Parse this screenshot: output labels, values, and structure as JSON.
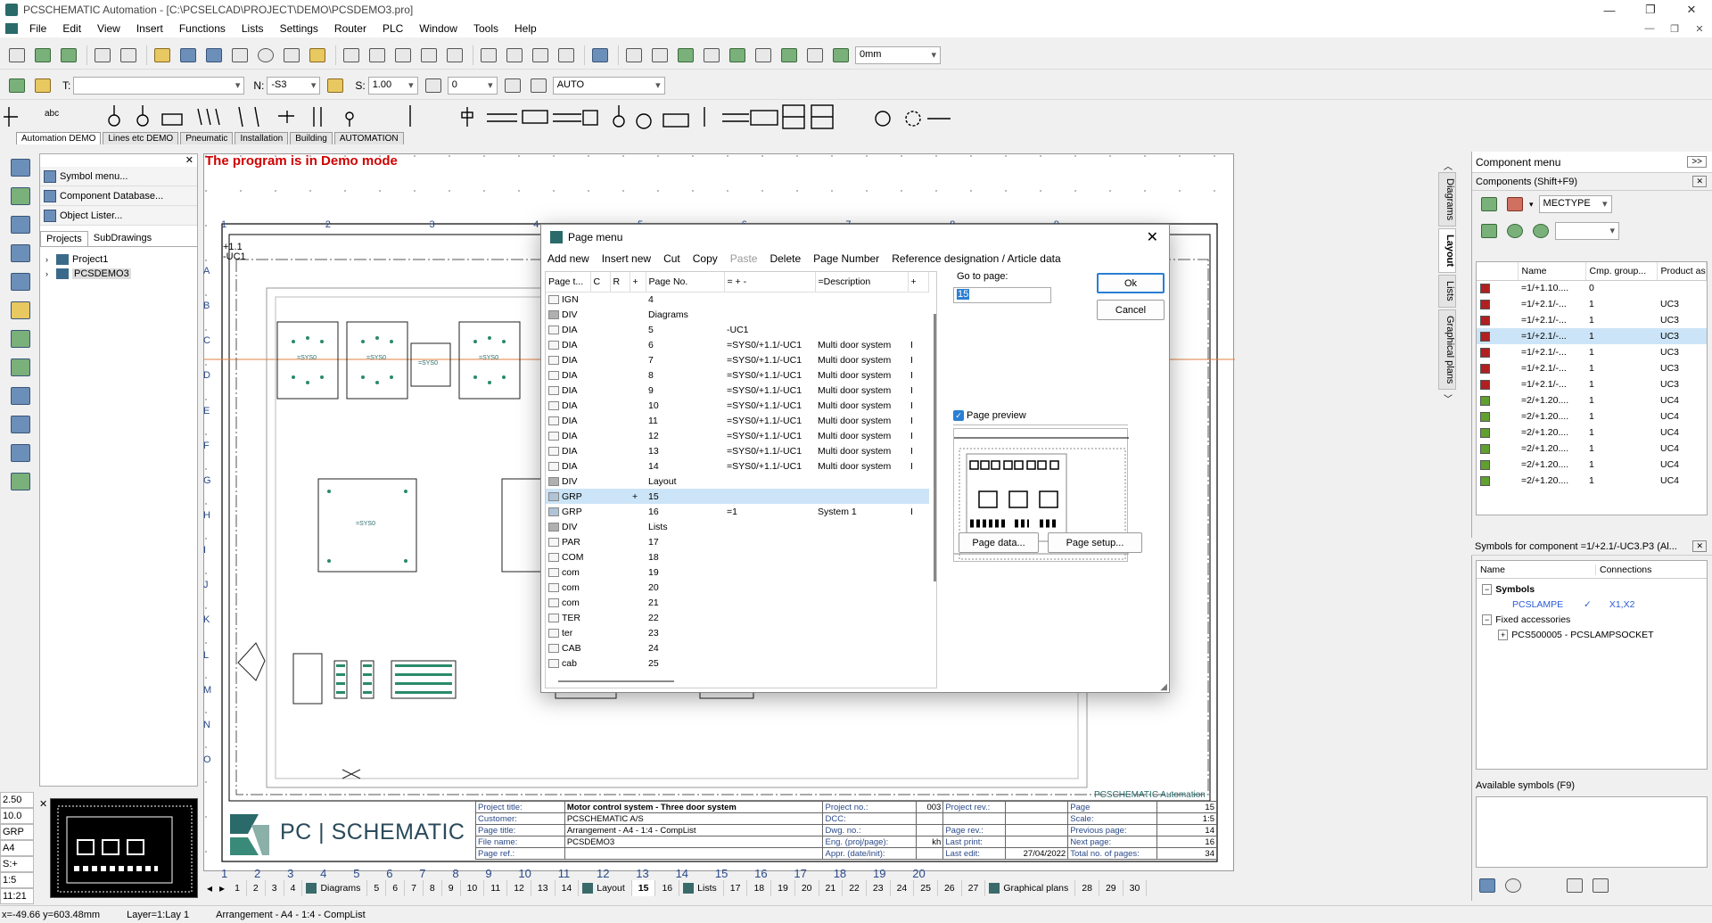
{
  "app": {
    "title": "PCSCHEMATIC Automation - [C:\\PCSELCAD\\PROJECT\\DEMO\\PCSDEMO3.pro]",
    "window_controls": [
      "—",
      "❐",
      "✕"
    ],
    "mdi_controls": [
      "—",
      "❐",
      "✕"
    ]
  },
  "menu": [
    "File",
    "Edit",
    "View",
    "Insert",
    "Functions",
    "Lists",
    "Settings",
    "Router",
    "PLC",
    "Window",
    "Tools",
    "Help"
  ],
  "toolbar1": {
    "zoom_value": "0mm"
  },
  "toolbar2": {
    "t_label": "T:",
    "n_label": "N:",
    "n_value": "-S3",
    "s_label": "S:",
    "s_value": "1.00",
    "angle_value": "0",
    "auto_value": "AUTO"
  },
  "symbol_tabs": [
    "Automation DEMO",
    "Lines etc DEMO",
    "Pneumatic",
    "Installation",
    "Building",
    "AUTOMATION"
  ],
  "left_panel": {
    "items": [
      "Symbol menu...",
      "Component Database...",
      "Object Lister..."
    ],
    "tabs": [
      "Projects",
      "SubDrawings"
    ],
    "tree": [
      "Project1",
      "PCSDEMO3"
    ]
  },
  "left_info": [
    "2.50",
    "10.0",
    "GRP",
    "A4",
    "S:+",
    "1:5",
    "11:21"
  ],
  "canvas": {
    "demo_notice": "The program is in Demo mode",
    "logo_text": "PC | SCHEMATIC",
    "company_label": "PCSCHEMATIC Automation",
    "col_numbers": [
      "1",
      "2",
      "3",
      "4",
      "5",
      "6",
      "7",
      "8",
      "9",
      "10",
      "11",
      "12",
      "13",
      "14",
      "15",
      "16",
      "17",
      "18",
      "19",
      "20"
    ],
    "row_letters": [
      "A",
      "B",
      "C",
      "D",
      "E",
      "F",
      "G",
      "H",
      "I",
      "J",
      "K",
      "L",
      "M",
      "N",
      "O"
    ],
    "ref_label": "+1.1\n-UC1"
  },
  "title_block": {
    "rows": [
      [
        "Project title:",
        "Motor control system - Three door system",
        "Project no.:",
        "003",
        "Project rev.:",
        "",
        "Page",
        "15"
      ],
      [
        "Customer:",
        "PCSCHEMATIC A/S",
        "DCC:",
        "",
        "",
        "",
        "Scale:",
        "1:5"
      ],
      [
        "Page title:",
        "Arrangement - A4 - 1:4 - CompList",
        "Dwg. no.:",
        "",
        "Page rev.:",
        "",
        "Previous page:",
        "14"
      ],
      [
        "File name:",
        "PCSDEMO3",
        "Eng. (proj/page):",
        "kh",
        "Last print:",
        "",
        "Next page:",
        "16"
      ],
      [
        "Page ref.:",
        "",
        "Appr. (date/init):",
        "",
        "Last edit:",
        "27/04/2022",
        "Total no. of pages:",
        "34"
      ]
    ]
  },
  "page_bar": [
    {
      "label": "1"
    },
    {
      "label": "2"
    },
    {
      "label": "3"
    },
    {
      "label": "4"
    },
    {
      "label": "Diagrams",
      "named": true
    },
    {
      "label": "5"
    },
    {
      "label": "6"
    },
    {
      "label": "7"
    },
    {
      "label": "8"
    },
    {
      "label": "9"
    },
    {
      "label": "10"
    },
    {
      "label": "11"
    },
    {
      "label": "12"
    },
    {
      "label": "13"
    },
    {
      "label": "14"
    },
    {
      "label": "Layout",
      "named": true
    },
    {
      "label": "15",
      "current": true
    },
    {
      "label": "16"
    },
    {
      "label": "Lists",
      "named": true
    },
    {
      "label": "17"
    },
    {
      "label": "18"
    },
    {
      "label": "19"
    },
    {
      "label": "20"
    },
    {
      "label": "21"
    },
    {
      "label": "22"
    },
    {
      "label": "23"
    },
    {
      "label": "24"
    },
    {
      "label": "25"
    },
    {
      "label": "26"
    },
    {
      "label": "27"
    },
    {
      "label": "Graphical plans",
      "named": true
    },
    {
      "label": "28"
    },
    {
      "label": "29"
    },
    {
      "label": "30"
    }
  ],
  "status": {
    "coords": "x=-49.66 y=603.48mm",
    "layer": "Layer=1:Lay 1",
    "page": "Arrangement - A4 - 1:4 - CompList"
  },
  "vertical_tabs": [
    "Diagrams",
    "Layout",
    "Lists",
    "Graphical plans"
  ],
  "right_panel": {
    "title": "Component menu",
    "expand": ">>",
    "components_label": "Components (Shift+F9)",
    "filter_value": "MECTYPE",
    "columns": [
      "Name",
      "Cmp. group...",
      "Product as"
    ],
    "rows": [
      {
        "color": "#b02020",
        "name": "=1/+1.10....",
        "grp": "0",
        "prod": ""
      },
      {
        "color": "#b02020",
        "name": "=1/+2.1/-...",
        "grp": "1",
        "prod": "UC3"
      },
      {
        "color": "#b02020",
        "name": "=1/+2.1/-...",
        "grp": "1",
        "prod": "UC3"
      },
      {
        "color": "#b02020",
        "name": "=1/+2.1/-...",
        "grp": "1",
        "prod": "UC3",
        "selected": true
      },
      {
        "color": "#b02020",
        "name": "=1/+2.1/-...",
        "grp": "1",
        "prod": "UC3"
      },
      {
        "color": "#b02020",
        "name": "=1/+2.1/-...",
        "grp": "1",
        "prod": "UC3"
      },
      {
        "color": "#b02020",
        "name": "=1/+2.1/-...",
        "grp": "1",
        "prod": "UC3"
      },
      {
        "color": "#60a030",
        "name": "=2/+1.20....",
        "grp": "1",
        "prod": "UC4"
      },
      {
        "color": "#60a030",
        "name": "=2/+1.20....",
        "grp": "1",
        "prod": "UC4"
      },
      {
        "color": "#60a030",
        "name": "=2/+1.20....",
        "grp": "1",
        "prod": "UC4"
      },
      {
        "color": "#60a030",
        "name": "=2/+1.20....",
        "grp": "1",
        "prod": "UC4"
      },
      {
        "color": "#60a030",
        "name": "=2/+1.20....",
        "grp": "1",
        "prod": "UC4"
      },
      {
        "color": "#60a030",
        "name": "=2/+1.20....",
        "grp": "1",
        "prod": "UC4"
      }
    ],
    "symbols_label": "Symbols for component =1/+2.1/-UC3.P3 (Al...",
    "sym_columns": [
      "Name",
      "Connections"
    ],
    "sym_tree": {
      "symbols": "Symbols",
      "lamp": "PCSLAMPE",
      "lamp_conn": "X1,X2",
      "fixed": "Fixed accessories",
      "socket": "PCS500005 - PCSLAMPSOCKET"
    },
    "available_label": "Available symbols (F9)"
  },
  "dialog": {
    "title": "Page menu",
    "menu": [
      {
        "label": "Add new"
      },
      {
        "label": "Insert new"
      },
      {
        "label": "Cut"
      },
      {
        "label": "Copy"
      },
      {
        "label": "Paste",
        "disabled": true
      },
      {
        "label": "Delete"
      },
      {
        "label": "Page Number"
      },
      {
        "label": "Reference designation / Article data"
      }
    ],
    "columns": [
      "Page t...",
      "C",
      "R",
      "+",
      "Page No.",
      "= + -",
      "=Description",
      "+"
    ],
    "rows": [
      {
        "type": "IGN",
        "plus": "",
        "no": "4",
        "ref": "",
        "desc": "",
        "kind": "page"
      },
      {
        "type": "DIV",
        "plus": "",
        "no": "Diagrams",
        "ref": "",
        "desc": "",
        "kind": "div"
      },
      {
        "type": "DIA",
        "plus": "",
        "no": "5",
        "ref": "-UC1",
        "desc": "",
        "kind": "page"
      },
      {
        "type": "DIA",
        "plus": "",
        "no": "6",
        "ref": "=SYS0/+1.1/-UC1",
        "desc": "Multi door system",
        "kind": "page"
      },
      {
        "type": "DIA",
        "plus": "",
        "no": "7",
        "ref": "=SYS0/+1.1/-UC1",
        "desc": "Multi door system",
        "kind": "page"
      },
      {
        "type": "DIA",
        "plus": "",
        "no": "8",
        "ref": "=SYS0/+1.1/-UC1",
        "desc": "Multi door system",
        "kind": "page"
      },
      {
        "type": "DIA",
        "plus": "",
        "no": "9",
        "ref": "=SYS0/+1.1/-UC1",
        "desc": "Multi door system",
        "kind": "page"
      },
      {
        "type": "DIA",
        "plus": "",
        "no": "10",
        "ref": "=SYS0/+1.1/-UC1",
        "desc": "Multi door system",
        "kind": "page"
      },
      {
        "type": "DIA",
        "plus": "",
        "no": "11",
        "ref": "=SYS0/+1.1/-UC1",
        "desc": "Multi door system",
        "kind": "page"
      },
      {
        "type": "DIA",
        "plus": "",
        "no": "12",
        "ref": "=SYS0/+1.1/-UC1",
        "desc": "Multi door system",
        "kind": "page"
      },
      {
        "type": "DIA",
        "plus": "",
        "no": "13",
        "ref": "=SYS0/+1.1/-UC1",
        "desc": "Multi door system",
        "kind": "page"
      },
      {
        "type": "DIA",
        "plus": "",
        "no": "14",
        "ref": "=SYS0/+1.1/-UC1",
        "desc": "Multi door system",
        "kind": "page"
      },
      {
        "type": "DIV",
        "plus": "",
        "no": "Layout",
        "ref": "",
        "desc": "",
        "kind": "div"
      },
      {
        "type": "GRP",
        "plus": "+",
        "no": "15",
        "ref": "",
        "desc": "",
        "kind": "grp",
        "selected": true
      },
      {
        "type": "GRP",
        "plus": "",
        "no": "16",
        "ref": "=1",
        "desc": "System 1",
        "kind": "grp"
      },
      {
        "type": "DIV",
        "plus": "",
        "no": "Lists",
        "ref": "",
        "desc": "",
        "kind": "div"
      },
      {
        "type": "PAR",
        "plus": "",
        "no": "17",
        "ref": "",
        "desc": "",
        "kind": "page"
      },
      {
        "type": "COM",
        "plus": "",
        "no": "18",
        "ref": "",
        "desc": "",
        "kind": "page"
      },
      {
        "type": "com",
        "plus": "",
        "no": "19",
        "ref": "",
        "desc": "",
        "kind": "page"
      },
      {
        "type": "com",
        "plus": "",
        "no": "20",
        "ref": "",
        "desc": "",
        "kind": "page"
      },
      {
        "type": "com",
        "plus": "",
        "no": "21",
        "ref": "",
        "desc": "",
        "kind": "page"
      },
      {
        "type": "TER",
        "plus": "",
        "no": "22",
        "ref": "",
        "desc": "",
        "kind": "page"
      },
      {
        "type": "ter",
        "plus": "",
        "no": "23",
        "ref": "",
        "desc": "",
        "kind": "page"
      },
      {
        "type": "CAB",
        "plus": "",
        "no": "24",
        "ref": "",
        "desc": "",
        "kind": "page"
      },
      {
        "type": "cab",
        "plus": "",
        "no": "25",
        "ref": "",
        "desc": "",
        "kind": "page"
      }
    ],
    "goto_label": "Go to page:",
    "goto_value": "15",
    "ok": "Ok",
    "cancel": "Cancel",
    "preview_label": "Page preview",
    "page_data": "Page data...",
    "page_setup": "Page setup..."
  }
}
